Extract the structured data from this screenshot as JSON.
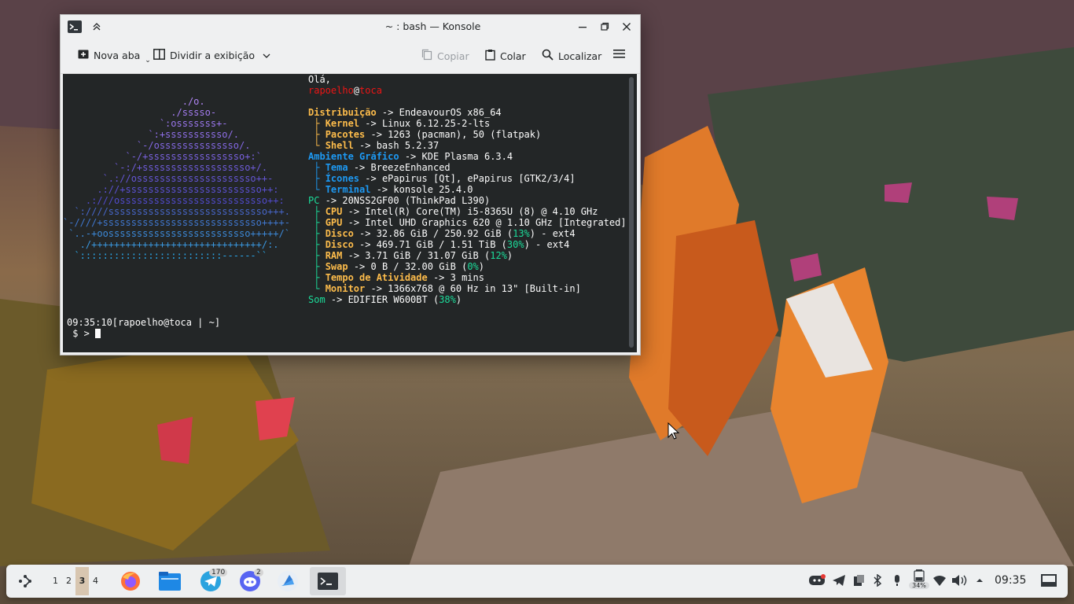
{
  "window": {
    "title": "~ : bash — Konsole",
    "toolbar": {
      "new_tab": "Nova aba",
      "split_view": "Dividir a exibição",
      "copy": "Copiar",
      "paste": "Colar",
      "find": "Localizar"
    }
  },
  "terminal": {
    "logo_lines": [
      "                     ./o.",
      "                   ./sssso-",
      "                 `:osssssss+-",
      "               `:+sssssssssso/.",
      "             `-/ossssssssssssso/.",
      "           `-/+sssssssssssssssso+:`",
      "         `-:/+sssssssssssssssssso+/.",
      "       `.://osssssssssssssssssssso++-",
      "      .://+ssssssssssssssssssssssso++:",
      "    .:///ossssssssssssssssssssssssso++:",
      "  `:////ssssssssssssssssssssssssssso+++.",
      "`-////+ssssssssssssssssssssssssssso++++-",
      " `..-+oosssssssssssssssssssssssso+++++/`",
      "   ./++++++++++++++++++++++++++++++/:.",
      "  `:::::::::::::::::::::::::------``"
    ],
    "greeting": "Olá,",
    "user": "rapoelho",
    "at": "@",
    "host": "toca",
    "rows": [
      {
        "prefix": "",
        "key": "Distribuição",
        "value": " -> EndeavourOS x86_64",
        "style": "or"
      },
      {
        "prefix": " ├ ",
        "key": "Kernel",
        "value": " -> Linux 6.12.25-2-lts",
        "style": "or"
      },
      {
        "prefix": " ├ ",
        "key": "Pacotes",
        "value": " -> 1263 (pacman), 50 (flatpak)",
        "style": "or"
      },
      {
        "prefix": " └ ",
        "key": "Shell",
        "value": " -> bash 5.2.37",
        "style": "or"
      },
      {
        "prefix": "",
        "key": "Ambiente Gráfico",
        "value": " -> KDE Plasma 6.3.4",
        "style": "bl"
      },
      {
        "prefix": " ├ ",
        "key": "Tema",
        "value": " -> BreezeEnhanced",
        "style": "bl"
      },
      {
        "prefix": " ├ ",
        "key": "Ícones",
        "value": " -> ePapirus [Qt], ePapirus [GTK2/3/4]",
        "style": "bl"
      },
      {
        "prefix": " └ ",
        "key": "Terminal",
        "value": " -> konsole 25.4.0",
        "style": "bl"
      }
    ],
    "pc": {
      "key": "PC",
      "value": " -> 20NSS2GF00 (ThinkPad L390)"
    },
    "hw_rows": [
      {
        "prefix": " ├ ",
        "key": "CPU",
        "value": " -> Intel(R) Core(TM) i5-8365U (8) @ 4.10 GHz",
        "pct": "",
        "tail": ""
      },
      {
        "prefix": " ├ ",
        "key": "GPU",
        "value": " -> Intel UHD Graphics 620 @ 1.10 GHz [Integrated]",
        "pct": "",
        "tail": ""
      },
      {
        "prefix": " ├ ",
        "key": "Disco",
        "value": " -> 32.86 GiB / 250.92 GiB (",
        "pct": "13%",
        "tail": ") - ext4"
      },
      {
        "prefix": " ├ ",
        "key": "Disco",
        "value": " -> 469.71 GiB / 1.51 TiB (",
        "pct": "30%",
        "tail": ") - ext4"
      },
      {
        "prefix": " ├ ",
        "key": "RAM",
        "value": " -> 3.71 GiB / 31.07 GiB (",
        "pct": "12%",
        "tail": ")"
      },
      {
        "prefix": " ├ ",
        "key": "Swap",
        "value": " -> 0 B / 32.00 GiB (",
        "pct": "0%",
        "tail": ")"
      },
      {
        "prefix": " ├ ",
        "key": "Tempo de Atividade",
        "value": " -> 3 mins",
        "pct": "",
        "tail": ""
      },
      {
        "prefix": " └ ",
        "key": "Monitor",
        "value": " -> 1366x768 @ 60 Hz in 13\" [Built-in]",
        "pct": "",
        "tail": ""
      }
    ],
    "sound": {
      "key": "Som",
      "value": " -> EDIFIER W600BT (",
      "pct": "38%",
      "tail": ")"
    },
    "prompt_line1": "09:35:10[rapoelho@toca | ~]",
    "prompt_line2": " $ > "
  },
  "taskbar": {
    "desktops": [
      "1",
      "2",
      "3",
      "4"
    ],
    "current_desktop": "3",
    "telegram_badge": "170",
    "discord_badge": "2",
    "battery_pct": "34%",
    "clock": "09:35"
  }
}
